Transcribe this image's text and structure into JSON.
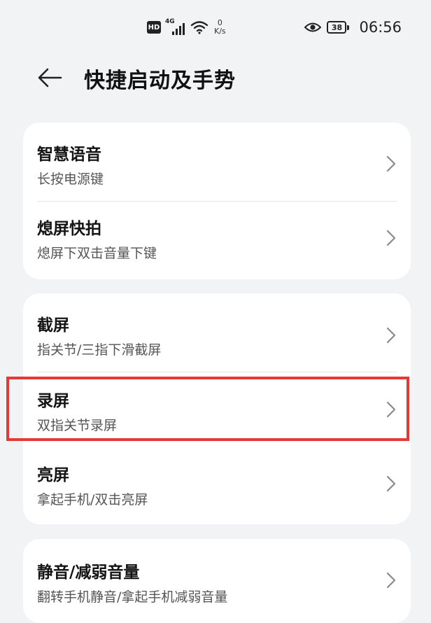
{
  "status_bar": {
    "hd_badge": "HD",
    "network_type": "4G",
    "speed_value": "0",
    "speed_unit": "K/s",
    "battery_level": "38",
    "time": "06:56"
  },
  "header": {
    "title": "快捷启动及手势"
  },
  "groups": [
    {
      "items": [
        {
          "title": "智慧语音",
          "subtitle": "长按电源键"
        },
        {
          "title": "熄屏快拍",
          "subtitle": "熄屏下双击音量下键"
        }
      ]
    },
    {
      "items": [
        {
          "title": "截屏",
          "subtitle": "指关节/三指下滑截屏"
        },
        {
          "title": "录屏",
          "subtitle": "双指关节录屏"
        },
        {
          "title": "亮屏",
          "subtitle": "拿起手机/双击亮屏"
        }
      ]
    },
    {
      "items": [
        {
          "title": "静音/减弱音量",
          "subtitle": "翻转手机静音/拿起手机减弱音量"
        }
      ]
    }
  ],
  "colors": {
    "background": "#f1f3f5",
    "card": "#ffffff",
    "highlight": "#e53935"
  }
}
